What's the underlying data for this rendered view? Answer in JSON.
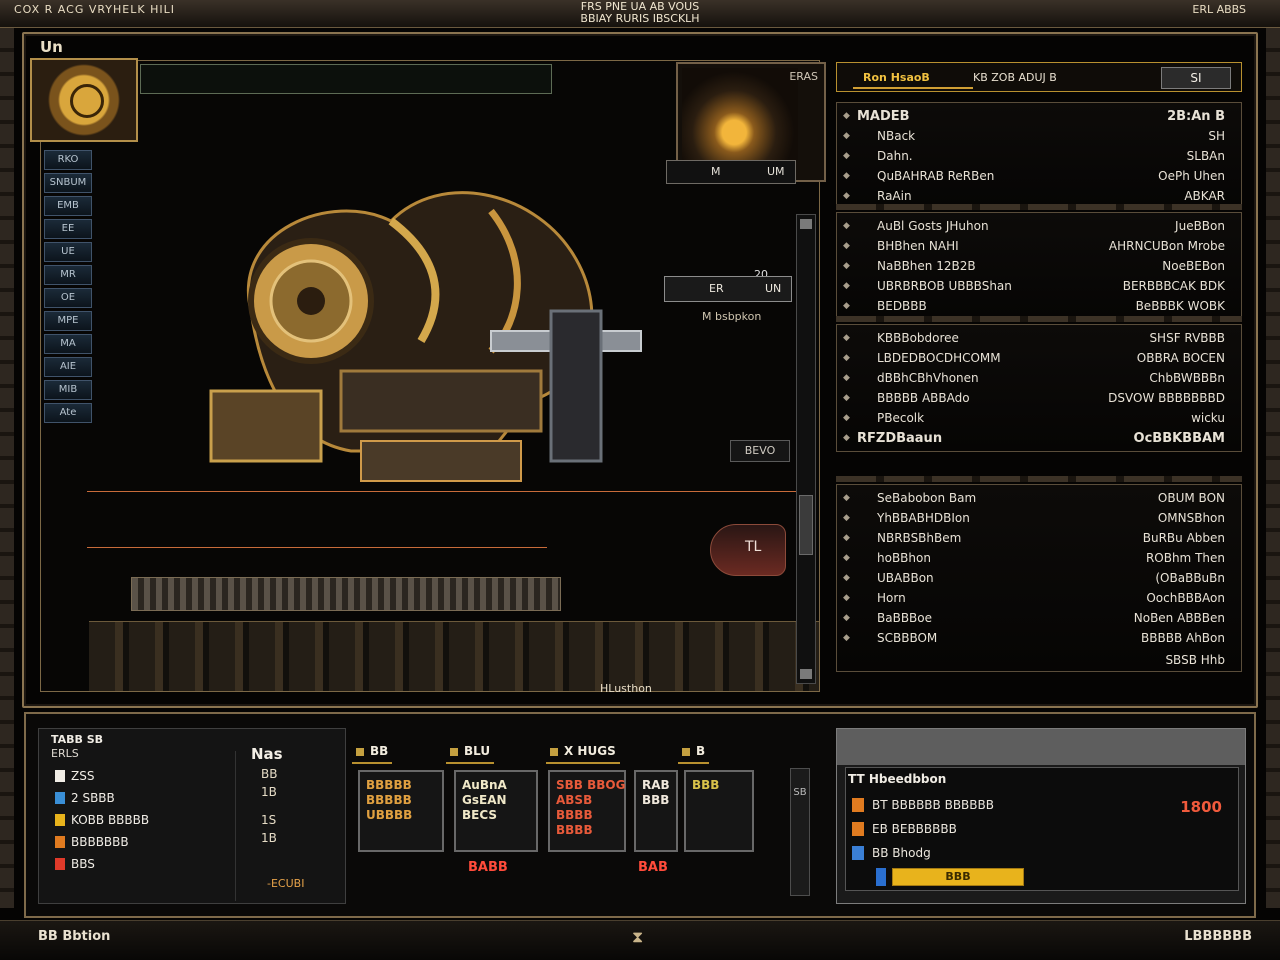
{
  "topbar": {
    "left": "COX R ACG VRYHELK HILI",
    "center_line1": "FRS PNE UA AB VOUS",
    "center_line2": "BBIAY RURIS IBSCKLH",
    "right": "ERL ABBS"
  },
  "window_label": "Un",
  "viewport": {
    "side_tabs": [
      "RKO",
      "SNBUM",
      "EMB",
      "EE",
      "UE",
      "MR",
      "OE",
      "MPE",
      "MA",
      "AIE",
      "MIB",
      "Ate"
    ],
    "thumb_label": "ERAS",
    "thumb_bar": {
      "left": "M",
      "right": "UM"
    },
    "pop_box": {
      "left": "ER",
      "right": "UN"
    },
    "pop_text": "M bsbpkon",
    "mini_badge": "20",
    "bevo": "BEVO",
    "pod_label": "TL",
    "bottom_caption": "HLusthon"
  },
  "right_panel": {
    "header": {
      "tab1": "Ron HsaoB",
      "tab2": "KB ZOB ADUJ B",
      "button": "SI"
    },
    "groups": [
      {
        "rows": [
          {
            "label": "MADEB",
            "value": "2B:An B",
            "title": true
          },
          {
            "label": "NBack",
            "value": "SH"
          },
          {
            "label": "Dahn.",
            "value": "SLBAn"
          },
          {
            "label": "QuBAHRAB ReRBen",
            "value": "OePh Uhen"
          },
          {
            "label": "RaAin",
            "value": "ABKAR"
          }
        ]
      },
      {
        "rows": [
          {
            "label": "AuBl Gosts JHuhon",
            "value": "JueBBon"
          },
          {
            "label": "BHBhen NAHI",
            "value": "AHRNCUBon Mrobe"
          },
          {
            "label": "NaBBhen 12B2B",
            "value": "NoeBEBon"
          },
          {
            "label": "UBRBRBOB UBBBShan",
            "value": "BERBBBCAK BDK"
          },
          {
            "label": "BEDBBB",
            "value": "BeBBBK WOBK"
          }
        ]
      },
      {
        "rows": [
          {
            "label": "KBBBobdoree",
            "value": "SHSF RVBBB"
          },
          {
            "label": "LBDEDBOCDHCOMM",
            "value": "OBBRA BOCEN"
          },
          {
            "label": "dBBhCBhVhonen",
            "value": "ChbBWBBBn"
          },
          {
            "label": "BBBBB ABBAdo",
            "value": "DSVOW BBBBBBBD"
          },
          {
            "label": "PBecolk",
            "value": "wicku"
          },
          {
            "label": "RFZDBaaun",
            "value": "OcBBKBBAM",
            "title": true
          }
        ]
      },
      {
        "rows": [
          {
            "label": "SeBabobon Bam",
            "value": "OBUM BON"
          },
          {
            "label": "YhBBABHDBIon",
            "value": "OMNSBhon"
          },
          {
            "label": "NBRBSBhBem",
            "value": "BuRBu Abben"
          },
          {
            "label": "hoBBhon",
            "value": "ROBhm Then"
          },
          {
            "label": "UBABBon",
            "value": "(OBaBBuBn"
          },
          {
            "label": "Horn",
            "value": "OochBBBAon"
          },
          {
            "label": "BaBBBoe",
            "value": "NoBen ABBBen"
          },
          {
            "label": "SCBBBOM",
            "value": "BBBBB AhBon"
          }
        ],
        "footer": "SBSB Hhb"
      }
    ]
  },
  "bottom_left": {
    "title": "TABB SB",
    "subtitle": "ERLS",
    "rows": [
      {
        "label": "ZSS",
        "color": "#f1ede6"
      },
      {
        "label": "2 SBBB",
        "color": "#3a8fd6"
      },
      {
        "label": "KOBB BBBBB",
        "color": "#e8b31c"
      },
      {
        "label": "BBBBBBB",
        "color": "#e07b20"
      },
      {
        "label": "BBS",
        "color": "#e03a2a"
      }
    ],
    "right_big": "Nas",
    "right_nums": [
      "BB",
      "1B",
      "1S",
      "1B"
    ],
    "right_foot": "-ECUBI"
  },
  "slots": {
    "tabs": [
      "BB",
      "BLU",
      "X HUGS",
      "B"
    ],
    "items": [
      {
        "text": "BBBBB\nBBBBB\nUBBBB",
        "color": "#e0a040"
      },
      {
        "text": "AuBnA\nGsEAN\nBECS",
        "color": "#f0e8c8"
      },
      {
        "text": "SBB BBOG\nABSB\nBBBB\nBBBB",
        "color": "#e85a3a"
      },
      {
        "text": "RAB\nBBB",
        "color": "#f0e8dc"
      },
      {
        "text": "BBB",
        "color": "#d8c24a"
      }
    ],
    "footers": [
      "BABB",
      "BAB"
    ],
    "scroll_label": "SB"
  },
  "bottom_right": {
    "head": "TT Hbeedbbon",
    "rows": [
      {
        "label": "BT BBBBBB BBBBBB",
        "color": "#e07b20"
      },
      {
        "label": "EB BEBBBBBB",
        "color": "#e07b20"
      },
      {
        "label": "BB Bhodg",
        "color": "#3a7fd6"
      }
    ],
    "value": "1800",
    "bar_label": "BBB"
  },
  "footer": {
    "left": "BB Bbtion",
    "right": "LBBBBBB"
  }
}
